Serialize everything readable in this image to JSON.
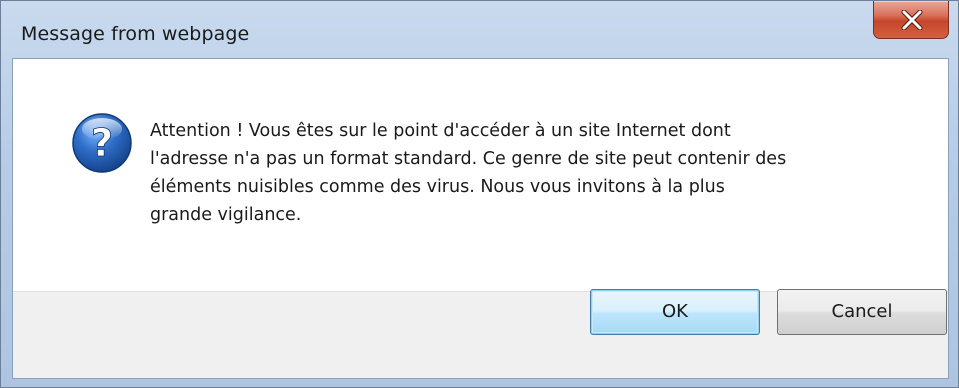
{
  "dialog": {
    "title": "Message from webpage",
    "close_icon": "close-x-icon",
    "icon": "question-mark-icon",
    "message": "Attention ! Vous êtes sur le point d'accéder à un site Internet dont\nl'adresse n'a pas un format standard.  Ce genre de site peut contenir des\néléments nuisibles comme des virus.  Nous vous invitons à la plus\ngrande vigilance.",
    "buttons": {
      "ok_label": "OK",
      "cancel_label": "Cancel"
    }
  },
  "colors": {
    "close_button": "#c6452b",
    "icon_blue": "#2f6fc9",
    "default_button_border": "#3c7fb1"
  }
}
